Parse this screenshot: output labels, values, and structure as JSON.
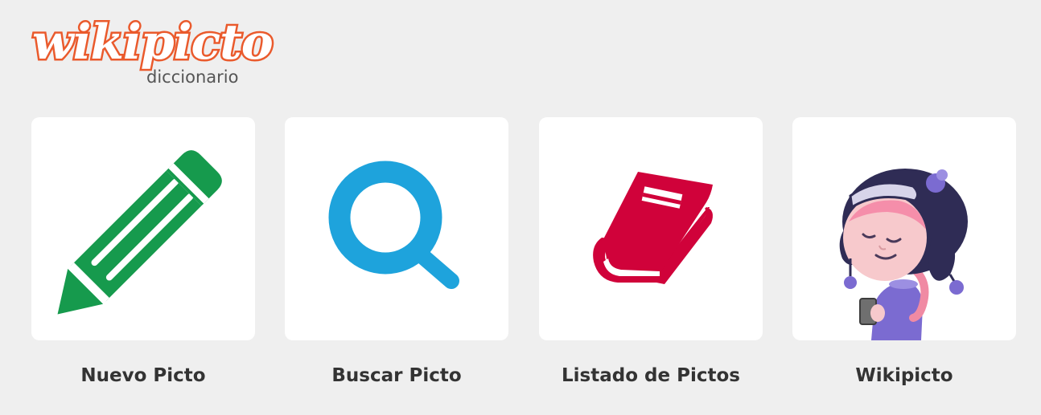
{
  "logo": {
    "wordmark": "wikipicto",
    "subtitle": "diccionario"
  },
  "cards": [
    {
      "label": "Nuevo Picto",
      "icon": "pencil-icon",
      "color": "#169a4d"
    },
    {
      "label": "Buscar Picto",
      "icon": "magnifier-icon",
      "color": "#1ea3dc"
    },
    {
      "label": "Listado de Pictos",
      "icon": "book-icon",
      "color": "#d0023a"
    },
    {
      "label": "Wikipicto",
      "icon": "girl-with-hat-illustration",
      "color": "#2f2c55"
    }
  ],
  "colors": {
    "background": "#efefef",
    "logo_orange": "#ea5a2c",
    "label_text": "#333333"
  }
}
